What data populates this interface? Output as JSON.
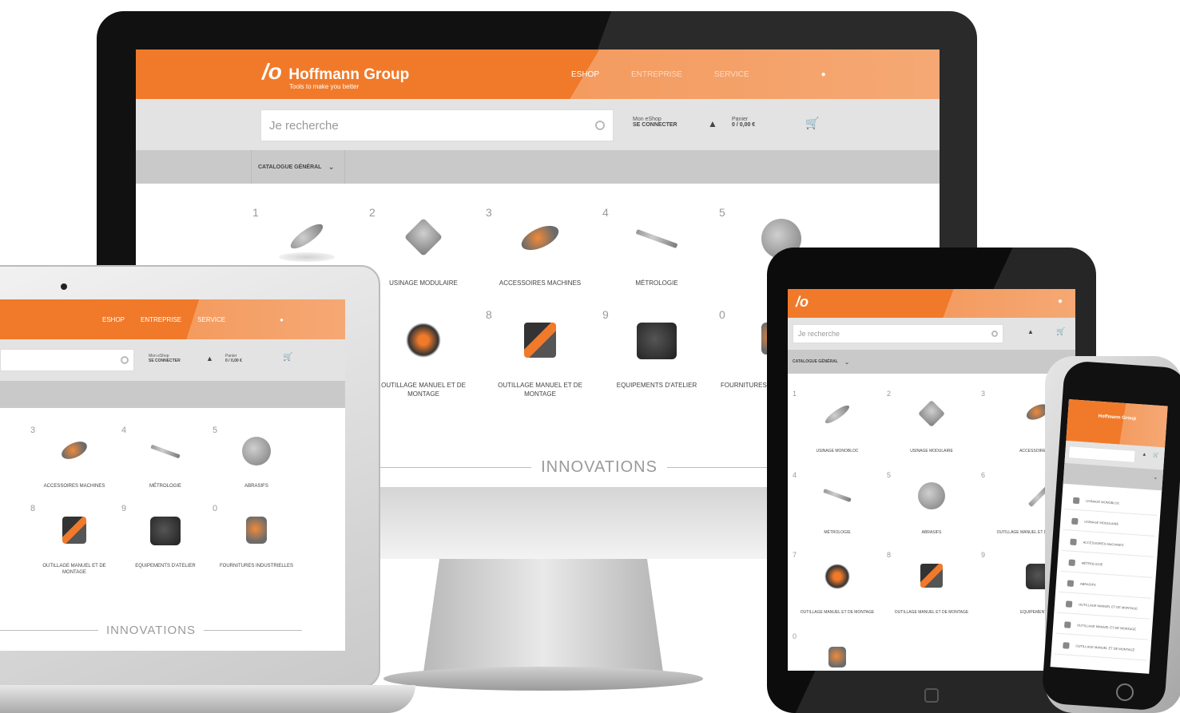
{
  "brand": {
    "name": "Hoffmann Group",
    "tagline": "Tools to make you better",
    "color": "#f07a2a"
  },
  "nav": {
    "eshop": "ESHOP",
    "entreprise": "ENTREPRISE",
    "service": "SERVICE"
  },
  "search": {
    "placeholder": "Je recherche"
  },
  "account": {
    "label": "Mon eShop",
    "action": "SE CONNECTER"
  },
  "cart": {
    "label": "Panier",
    "value": "0 / 0,00 €"
  },
  "catalog": {
    "label": "CATALOGUE GÉNÉRAL"
  },
  "categories": [
    {
      "num": "1",
      "label": "USINAGE MONOBLOC"
    },
    {
      "num": "2",
      "label": "USINAGE MODULAIRE"
    },
    {
      "num": "3",
      "label": "ACCESSOIRES MACHINES"
    },
    {
      "num": "4",
      "label": "MÉTROLOGIE"
    },
    {
      "num": "5",
      "label": "ABRASIFS"
    },
    {
      "num": "6",
      "label": "OUTILLAGE MANUEL ET DE MONTAGE"
    },
    {
      "num": "7",
      "label": "OUTILLAGE MANUEL ET DE MONTAGE"
    },
    {
      "num": "8",
      "label": "OUTILLAGE MANUEL ET DE MONTAGE"
    },
    {
      "num": "9",
      "label": "EQUIPEMENTS D'ATELIER"
    },
    {
      "num": "0",
      "label": "FOURNITURES INDUSTRIELLES"
    }
  ],
  "innovations": "INNOVATIONS"
}
